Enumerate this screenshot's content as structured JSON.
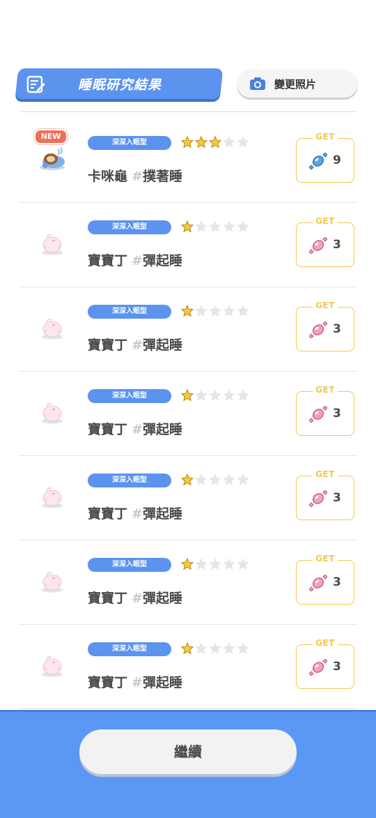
{
  "header": {
    "title": "睡眠研究結果",
    "change_photo_label": "變更照片"
  },
  "rows": [
    {
      "is_new": true,
      "new_label": "NEW",
      "sleep_type": "深深入眠型",
      "stars_filled": 3,
      "stars_total": 5,
      "name": "卡咪龜",
      "hash": "#",
      "style": "撲著睡",
      "get_label": "GET",
      "candy": "blue-candy-icon",
      "count": "9"
    },
    {
      "is_new": false,
      "sleep_type": "深深入眠型",
      "stars_filled": 1,
      "stars_total": 5,
      "name": "寶寶丁",
      "hash": "#",
      "style": "彈起睡",
      "get_label": "GET",
      "candy": "pink-candy-icon",
      "count": "3"
    },
    {
      "is_new": false,
      "sleep_type": "深深入眠型",
      "stars_filled": 1,
      "stars_total": 5,
      "name": "寶寶丁",
      "hash": "#",
      "style": "彈起睡",
      "get_label": "GET",
      "candy": "pink-candy-icon",
      "count": "3"
    },
    {
      "is_new": false,
      "sleep_type": "深深入眠型",
      "stars_filled": 1,
      "stars_total": 5,
      "name": "寶寶丁",
      "hash": "#",
      "style": "彈起睡",
      "get_label": "GET",
      "candy": "pink-candy-icon",
      "count": "3"
    },
    {
      "is_new": false,
      "sleep_type": "深深入眠型",
      "stars_filled": 1,
      "stars_total": 5,
      "name": "寶寶丁",
      "hash": "#",
      "style": "彈起睡",
      "get_label": "GET",
      "candy": "pink-candy-icon",
      "count": "3"
    },
    {
      "is_new": false,
      "sleep_type": "深深入眠型",
      "stars_filled": 1,
      "stars_total": 5,
      "name": "寶寶丁",
      "hash": "#",
      "style": "彈起睡",
      "get_label": "GET",
      "candy": "pink-candy-icon",
      "count": "3"
    },
    {
      "is_new": false,
      "sleep_type": "深深入眠型",
      "stars_filled": 1,
      "stars_total": 5,
      "name": "寶寶丁",
      "hash": "#",
      "style": "彈起睡",
      "get_label": "GET",
      "candy": "pink-candy-icon",
      "count": "3"
    }
  ],
  "footer": {
    "continue_label": "繼續"
  },
  "colors": {
    "accent": "#5b93ee",
    "star_filled": "#f6c843",
    "star_empty": "#e6e6e6",
    "get_border": "#f3c74a",
    "new_badge": "#ef6e57"
  }
}
